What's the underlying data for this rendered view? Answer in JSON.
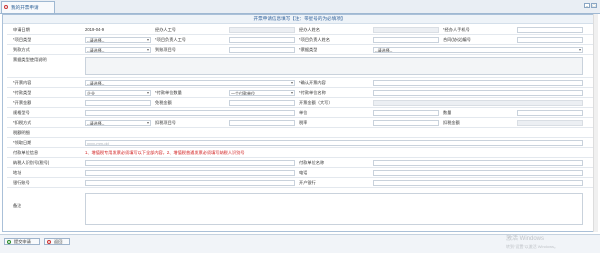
{
  "tab": {
    "label": "我的开票申请"
  },
  "form": {
    "title": "开票申请信息填写【注：带星号的为必填项】",
    "apply_date_label": "申请日期",
    "apply_date_value": "2019-04-9",
    "handler_label": "经办人工号",
    "handler_name_label": "经办人姓名",
    "handler_phone_label": "*经办人手机号",
    "project_type_label": "*项目类型",
    "project_type_value": "--请选择--",
    "project_leader_id_label": "*项目负责人工号",
    "project_leader_name_label": "*项目负责人姓名",
    "contract_no_label": "合同(协议)编号",
    "income_method_label": "到款方式",
    "income_method_value": "--请选择--",
    "project_code_label": "到账项目号",
    "invoice_type_label": "*票据类型",
    "invoice_type_value": "--请选择--",
    "usage_note_label": "票据类型使用说明",
    "invoice_content_label": "*开票内容",
    "invoice_content_value": "--请选择--",
    "confirm_content_label": "*确认开票内容",
    "payer_type_label": "*付款类型",
    "payer_type_value": "企业",
    "payer_count_label": "*付款单位数量",
    "payer_count_value": "一个付款单位",
    "payer_name_label": "*付款单位名称",
    "amount_label": "*开票金额",
    "tax_free_label": "免税金额",
    "amount_upper_label": "开票金额（大写）",
    "spec_label": "规格型号",
    "unit_label": "单位",
    "qty_label": "数量",
    "tax_method_label": "*扣税方式",
    "tax_method_value": "--请选择--",
    "tax_item_label": "扣税项目号",
    "tax_rate_label": "税率",
    "tax_amount_label": "扣税金额",
    "tax_detail_label": "税额明细",
    "expected_date_label": "*领取日期",
    "expected_date_placeholder": "yyyy-mm-dd",
    "payer_info_label": "付款单位信息",
    "payer_info_note": "1、增值税专用发票必须填写以下全部内容，2、增值税普通发票必须填写纳税人识别号",
    "taxpayer_id_label": "纳税人识别号(税号)",
    "payer_unit_label": "付款单位名称",
    "address_label": "地址",
    "phone_label": "电话",
    "bank_account_label": "银行账号",
    "bank_label": "开户银行",
    "remark_label": "备注"
  },
  "footer": {
    "submit_label": "提交申请",
    "back_label": "返回"
  },
  "watermark": {
    "line1": "激活 Windows",
    "line2": "转到“设置”以激活 Windows。"
  }
}
